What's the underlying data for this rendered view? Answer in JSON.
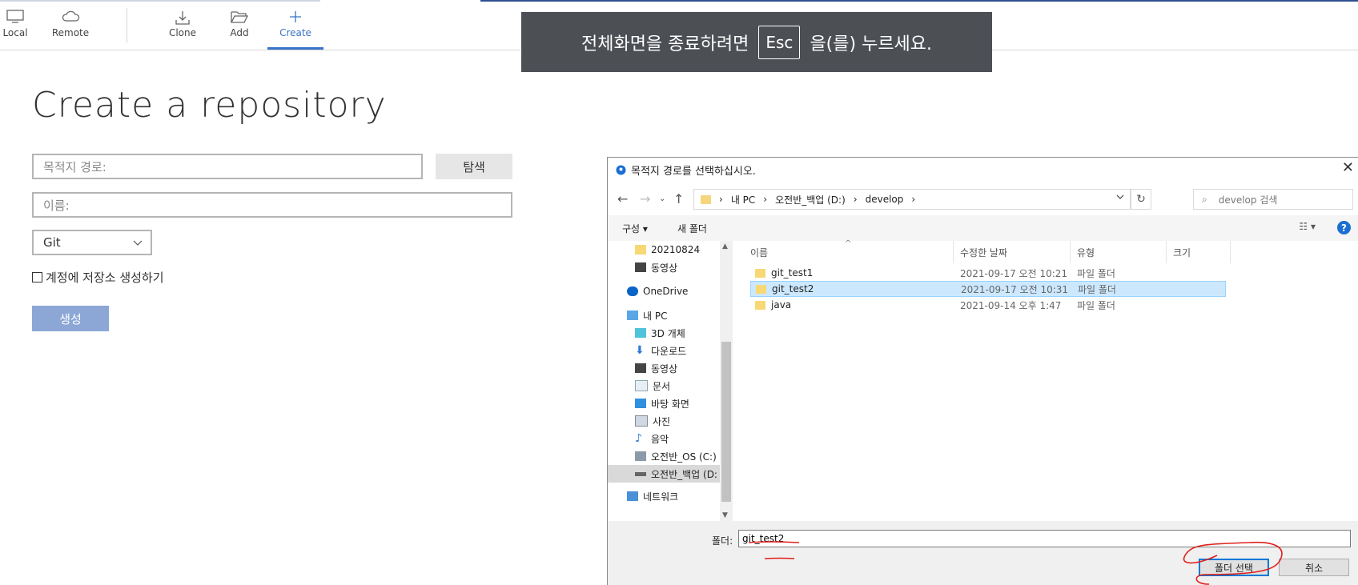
{
  "toolbar": {
    "local": "Local",
    "remote": "Remote",
    "clone": "Clone",
    "add": "Add",
    "create": "Create"
  },
  "toast": {
    "before": "전체화면을 종료하려면",
    "key": "Esc",
    "after": "을(를) 누르세요."
  },
  "form": {
    "title": "Create a repository",
    "path_placeholder": "목적지 경로:",
    "browse_label": "탐색",
    "name_placeholder": "이름:",
    "vcs_selected": "Git",
    "account_checkbox_label": "계정에 저장소 생성하기",
    "create_label": "생성"
  },
  "dialog": {
    "title": "목적지 경로를 선택하십시오.",
    "address": [
      "내 PC",
      "오전반_백업 (D:)",
      "develop"
    ],
    "search_placeholder": "develop 검색",
    "organize": "구성 ▾",
    "new_folder": "새 폴더",
    "nav": {
      "item0": "20210824",
      "item1": "동영상",
      "item2": "OneDrive",
      "item3": "내 PC",
      "item4": "3D 개체",
      "item5": "다운로드",
      "item6": "동영상",
      "item7": "문서",
      "item8": "바탕 화면",
      "item9": "사진",
      "item10": "음악",
      "item11": "오전반_OS (C:)",
      "item12": "오전반_백업 (D:",
      "item13": "네트워크"
    },
    "columns": {
      "name": "이름",
      "modified": "수정한 날짜",
      "type": "유형",
      "size": "크기"
    },
    "rows": [
      {
        "name": "git_test1",
        "modified": "2021-09-17 오전 10:21",
        "type": "파일 폴더"
      },
      {
        "name": "git_test2",
        "modified": "2021-09-17 오전 10:31",
        "type": "파일 폴더"
      },
      {
        "name": "java",
        "modified": "2021-09-14 오후 1:47",
        "type": "파일 폴더"
      }
    ],
    "folder_label": "폴더:",
    "folder_value": "git_test2",
    "select_button": "폴더 선택",
    "cancel_button": "취소"
  },
  "colors": {
    "accent": "#3973c7",
    "create_button": "#8ca7d6",
    "toast_bg": "#4c4f54",
    "selection": "#cce8ff",
    "annotation": "#e0201c"
  }
}
